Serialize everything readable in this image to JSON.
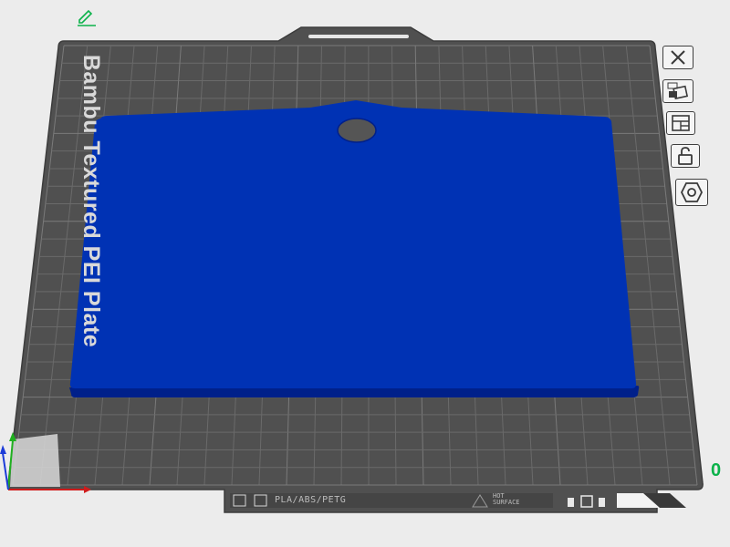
{
  "plate": {
    "name": "Bambu Textured PEI Plate",
    "filament_types": "PLA/ABS/PETG",
    "surface_text": "HOT\nSURFACE",
    "object_count": "0"
  },
  "colors": {
    "background": "#ececec",
    "plate": "#505050",
    "grid_line": "#6a6a6a",
    "model": "#0032b4",
    "accent_green": "#0bb24a",
    "axis_x": "#d01c1c",
    "axis_y": "#20b020",
    "axis_z": "#1c3cd8"
  },
  "toolbar": {
    "buttons": [
      {
        "name": "close-icon"
      },
      {
        "name": "auto-orient-icon"
      },
      {
        "name": "arrange-icon"
      },
      {
        "name": "lock-icon"
      },
      {
        "name": "plate-settings-icon"
      }
    ]
  },
  "top_left_tool": {
    "icon": "edit-pencil-icon"
  }
}
